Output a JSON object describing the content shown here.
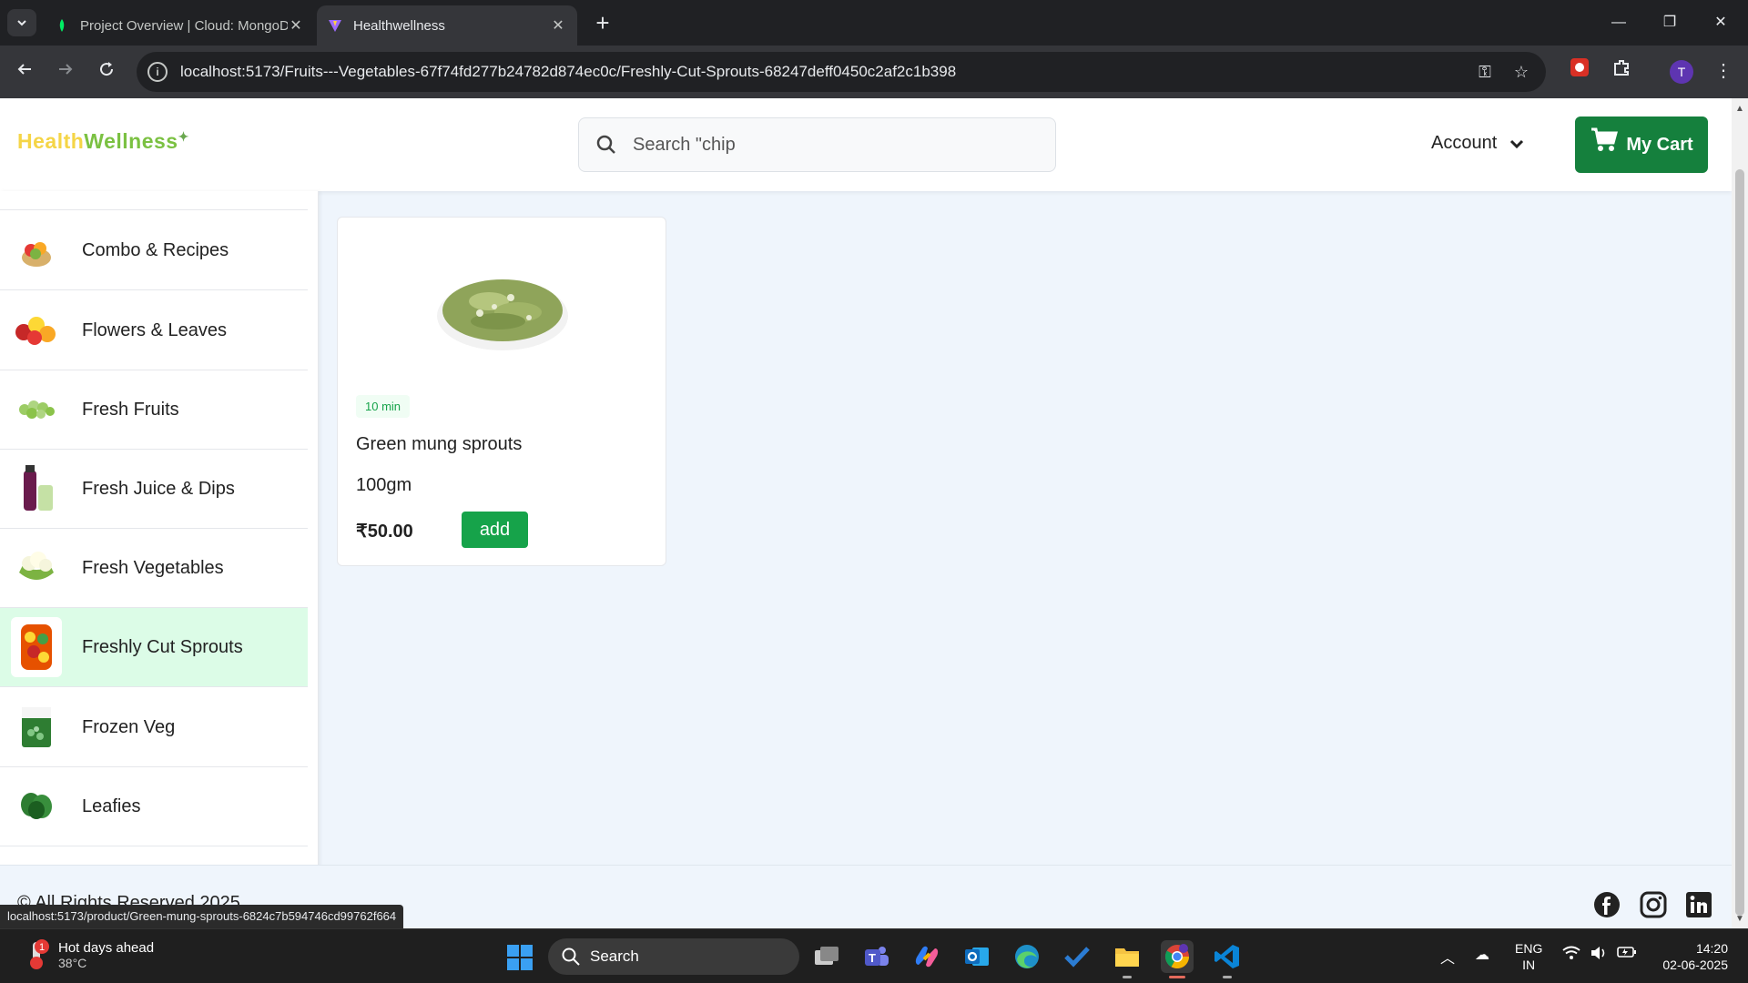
{
  "browser": {
    "tabs": [
      {
        "label": "Project Overview | Cloud: MongoDB Cloud",
        "active": false
      },
      {
        "label": "Healthwellness",
        "active": true
      }
    ],
    "url": "localhost:5173/Fruits---Vegetables-67f74fd277b24782d874ec0c/Freshly-Cut-Sprouts-68247deff0450c2af2c1b398",
    "profile_initial": "T",
    "status_url": "localhost:5173/product/Green-mung-sprouts-6824c7b594746cd99762f664"
  },
  "header": {
    "logo_part1": "Health",
    "logo_part2": "Wellness",
    "search_placeholder": "Search \"chip",
    "account_label": "Account",
    "cart_label": "My Cart"
  },
  "sidebar": {
    "categories": [
      {
        "label": "Combo & Recipes",
        "active": false
      },
      {
        "label": "Flowers & Leaves",
        "active": false
      },
      {
        "label": "Fresh Fruits",
        "active": false
      },
      {
        "label": "Fresh Juice & Dips",
        "active": false
      },
      {
        "label": "Fresh Vegetables",
        "active": false
      },
      {
        "label": "Freshly Cut Sprouts",
        "active": true
      },
      {
        "label": "Frozen Veg",
        "active": false
      },
      {
        "label": "Leafies",
        "active": false
      }
    ]
  },
  "product": {
    "delivery_time": "10 min",
    "name": "Green mung sprouts",
    "unit": "100gm",
    "price": "₹50.00",
    "add_label": "add"
  },
  "footer": {
    "copyright": "© All Rights Reserved 2025"
  },
  "taskbar": {
    "weather_title": "Hot days ahead",
    "weather_temp": "38°C",
    "weather_badge": "1",
    "search_label": "Search",
    "lang_line1": "ENG",
    "lang_line2": "IN",
    "time": "14:20",
    "date": "02-06-2025"
  },
  "colors": {
    "brand_green": "#15803d",
    "add_green": "#16a34a",
    "active_category_bg": "#dcfce7",
    "page_bg": "#eff5fc"
  }
}
